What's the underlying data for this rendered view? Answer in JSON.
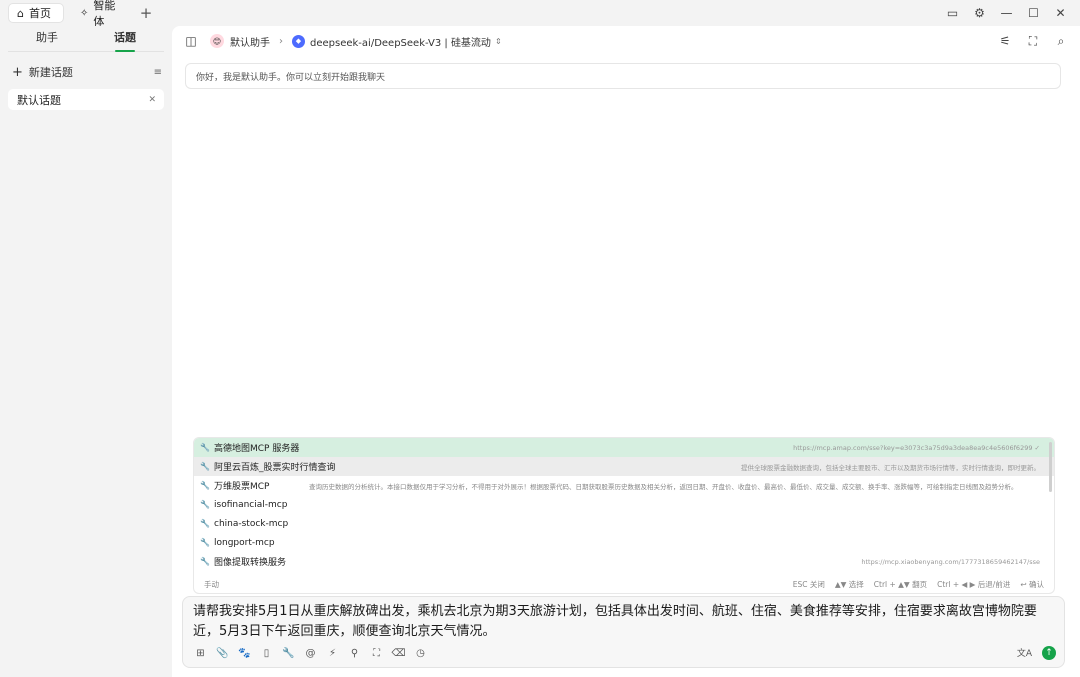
{
  "titlebar": {
    "tabs": [
      {
        "label": "首页",
        "icon": "home-icon"
      },
      {
        "label": "智能体",
        "icon": "sparkle-icon"
      }
    ]
  },
  "sidebar": {
    "tabs": [
      "助手",
      "话题"
    ],
    "active_tab": "话题",
    "new_topic_label": "新建话题",
    "topics": [
      {
        "label": "默认话题"
      }
    ]
  },
  "header": {
    "assistant": "默认助手",
    "model": "deepseek-ai/DeepSeek-V3 | 硅基流动"
  },
  "chat": {
    "greeting": "你好，我是默认助手。你可以立刻开始跟我聊天"
  },
  "mcp_popup": {
    "items": [
      {
        "name": "高德地图MCP 服务器",
        "desc": "",
        "right": "https://mcp.amap.com/sse?key=e3073c3a75d9a3dea8ea9c4e5606f6299 ✓"
      },
      {
        "name": "阿里云百炼_股票实时行情查询",
        "desc": "",
        "right": "提供全球股票金融数据查询，包括全球主要股市、汇市以及期货市场行情等，实时行情查询，即时更新。"
      },
      {
        "name": "万维股票MCP",
        "desc": "查询历史数据的分析统计。本接口数据仅用于学习分析，不得用于对外展示！根据股票代码、日期获取股票历史数据及相关分析，返回日期、开盘价、收盘价、最高价、最低价、成交量、成交额、换手率、涨跌幅等，可绘制指定日线图及趋势分析。",
        "right": ""
      },
      {
        "name": "isofinancial-mcp",
        "desc": "",
        "right": ""
      },
      {
        "name": "china-stock-mcp",
        "desc": "",
        "right": ""
      },
      {
        "name": "longport-mcp",
        "desc": "",
        "right": ""
      },
      {
        "name": "图像提取转换服务",
        "desc": "",
        "right": "https://mcp.xiaobenyang.com/1777318659462147/sse"
      }
    ],
    "footer_left": "手动",
    "hints": [
      "ESC 关闭",
      "▲▼ 选择",
      "Ctrl + ▲▼ 翻页",
      "Ctrl + ◀ ▶ 后退/前进",
      "↩ 确认"
    ]
  },
  "input": {
    "text": "请帮我安排5月1日从重庆解放碑出发，乘机去北京为期3天旅游计划，包括具体出发时间、航班、住宿、美食推荐等安排，住宿要求离故宫博物院要近，5月3日下午返回重庆，顺便查询北京天气情况。"
  },
  "colors": {
    "accent": "#16a34a",
    "highlight": "#d6efe0"
  }
}
